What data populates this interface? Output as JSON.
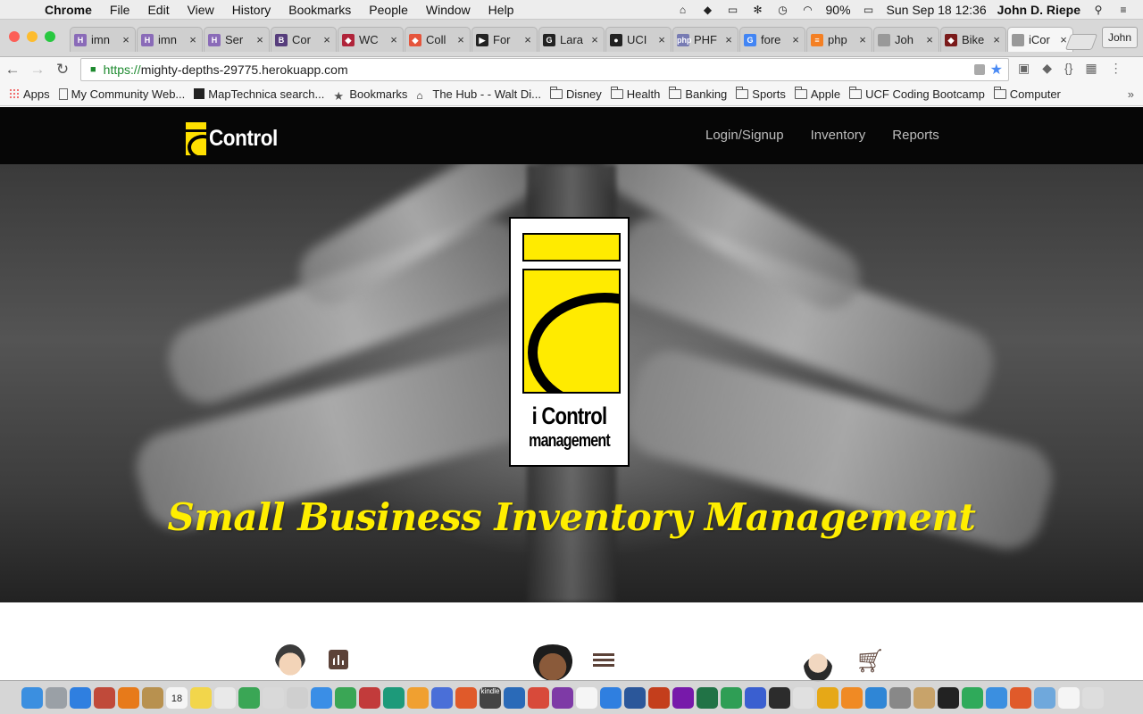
{
  "menubar": {
    "app": "Chrome",
    "items": [
      "File",
      "Edit",
      "View",
      "History",
      "Bookmarks",
      "People",
      "Window",
      "Help"
    ],
    "battery": "90%",
    "datetime": "Sun Sep 18  12:36",
    "user": "John D. Riepe"
  },
  "tabs": [
    {
      "label": "imn",
      "fav_color": "#8a6bb8",
      "fav_glyph": "H"
    },
    {
      "label": "imn",
      "fav_color": "#8a6bb8",
      "fav_glyph": "H"
    },
    {
      "label": "Ser",
      "fav_color": "#8a6bb8",
      "fav_glyph": "H"
    },
    {
      "label": "Cor",
      "fav_color": "#563d7c",
      "fav_glyph": "B"
    },
    {
      "label": "WC",
      "fav_color": "#b0243a",
      "fav_glyph": "◆"
    },
    {
      "label": "Coll",
      "fav_color": "#e5553c",
      "fav_glyph": "◆"
    },
    {
      "label": "For",
      "fav_color": "#222222",
      "fav_glyph": "▶"
    },
    {
      "label": "Lara",
      "fav_color": "#222222",
      "fav_glyph": "G"
    },
    {
      "label": "UCI",
      "fav_color": "#222222",
      "fav_glyph": "●"
    },
    {
      "label": "PHF",
      "fav_color": "#777bb3",
      "fav_glyph": "php"
    },
    {
      "label": "fore",
      "fav_color": "#4285f4",
      "fav_glyph": "G"
    },
    {
      "label": "php",
      "fav_color": "#f48024",
      "fav_glyph": "≡"
    },
    {
      "label": "Joh",
      "fav_color": "#999999",
      "fav_glyph": ""
    },
    {
      "label": "Bike",
      "fav_color": "#7a1a1a",
      "fav_glyph": "◆"
    },
    {
      "label": "iCor",
      "fav_color": "#999999",
      "fav_glyph": "",
      "active": true
    }
  ],
  "profile_button": "John",
  "address": {
    "scheme": "https://",
    "host": "mighty-depths-29775.herokuapp.com"
  },
  "bookmarks": [
    {
      "label": "Apps",
      "icon": "apps-icon"
    },
    {
      "label": "My Community Web...",
      "icon": "page-icon"
    },
    {
      "label": "MapTechnica search...",
      "icon": "map-icon"
    },
    {
      "label": "Bookmarks",
      "icon": "star-icon"
    },
    {
      "label": "The Hub - - Walt Di...",
      "icon": "disney-icon"
    },
    {
      "label": "Disney",
      "icon": "folder-icon"
    },
    {
      "label": "Health",
      "icon": "folder-icon"
    },
    {
      "label": "Banking",
      "icon": "folder-icon"
    },
    {
      "label": "Sports",
      "icon": "folder-icon"
    },
    {
      "label": "Apple",
      "icon": "folder-icon"
    },
    {
      "label": "UCF Coding Bootcamp",
      "icon": "folder-icon"
    },
    {
      "label": "Computer",
      "icon": "folder-icon"
    }
  ],
  "site": {
    "brand": "Control",
    "nav": [
      "Login/Signup",
      "Inventory",
      "Reports"
    ],
    "logo_line1": "i Control",
    "logo_line2": "management",
    "tagline": "Small Business Inventory Management",
    "accent": "#ffeb00"
  },
  "features": [
    {
      "avatar": "avatar-man-icon",
      "icon": "bar-chart-icon"
    },
    {
      "avatar": "avatar-curly-hair-icon",
      "icon": "list-icon"
    },
    {
      "avatar": "avatar-bearded-man-icon",
      "icon": "shopping-cart-icon"
    }
  ],
  "dock": {
    "kindle_label": "kindle",
    "calendar_day": "18"
  }
}
